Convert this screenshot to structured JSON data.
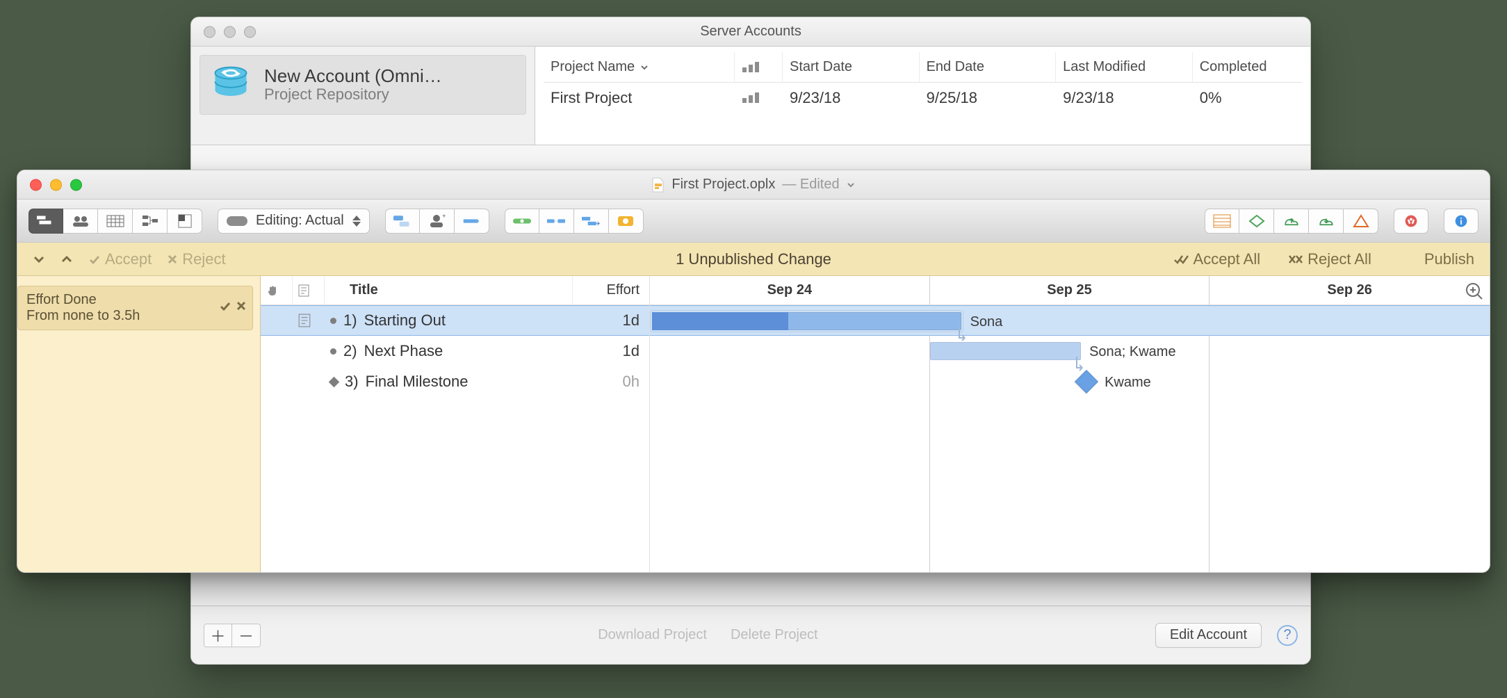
{
  "back_window": {
    "title": "Server Accounts",
    "sidebar": {
      "account_title": "New Account (Omni…",
      "account_subtitle": "Project Repository"
    },
    "columns": {
      "project_name": "Project Name",
      "start_date": "Start Date",
      "end_date": "End Date",
      "last_modified": "Last Modified",
      "completed": "Completed"
    },
    "rows": [
      {
        "project_name": "First Project",
        "start_date": "9/23/18",
        "end_date": "9/25/18",
        "last_modified": "9/23/18",
        "completed": "0%"
      }
    ],
    "footer": {
      "download": "Download Project",
      "delete": "Delete Project",
      "edit": "Edit Account"
    }
  },
  "front_window": {
    "doc_title": "First Project.oplx",
    "doc_state": "— Edited",
    "editing_label": "Editing: Actual",
    "change_bar": {
      "accept": "Accept",
      "reject": "Reject",
      "center": "1 Unpublished Change",
      "accept_all": "Accept All",
      "reject_all": "Reject All",
      "publish": "Publish"
    },
    "change_chip": {
      "line1": "Effort Done",
      "line2": "From none to 3.5h"
    },
    "outline": {
      "cols": {
        "title": "Title",
        "effort": "Effort"
      },
      "rows": [
        {
          "num": "1)",
          "title": "Starting Out",
          "effort": "1d",
          "type": "task",
          "selected": true
        },
        {
          "num": "2)",
          "title": "Next Phase",
          "effort": "1d",
          "type": "task",
          "selected": false
        },
        {
          "num": "3)",
          "title": "Final Milestone",
          "effort": "0h",
          "type": "milestone",
          "selected": false
        }
      ]
    },
    "gantt": {
      "days": [
        "Sep 24",
        "Sep 25",
        "Sep 26"
      ],
      "assignments": {
        "t1": "Sona",
        "t2": "Sona; Kwame",
        "t3": "Kwame"
      }
    }
  },
  "chart_data": {
    "type": "gantt",
    "title": "First Project",
    "x_axis_days": [
      "Sep 24",
      "Sep 25",
      "Sep 26"
    ],
    "tasks": [
      {
        "id": "t1",
        "name": "Starting Out",
        "day_start": "Sep 24",
        "day_end": "Sep 24",
        "effort": "1d",
        "percent_complete_approx": 44,
        "assignees": [
          "Sona"
        ],
        "selected": true
      },
      {
        "id": "t2",
        "name": "Next Phase",
        "day_start": "Sep 25",
        "day_end": "Sep 25",
        "effort": "1d",
        "percent_complete_approx": 0,
        "assignees": [
          "Sona",
          "Kwame"
        ],
        "depends_on": [
          "t1"
        ]
      },
      {
        "id": "t3",
        "name": "Final Milestone",
        "day_start": "Sep 25",
        "day_end": "Sep 25",
        "effort": "0h",
        "type": "milestone",
        "assignees": [
          "Kwame"
        ],
        "depends_on": [
          "t2"
        ]
      }
    ]
  }
}
